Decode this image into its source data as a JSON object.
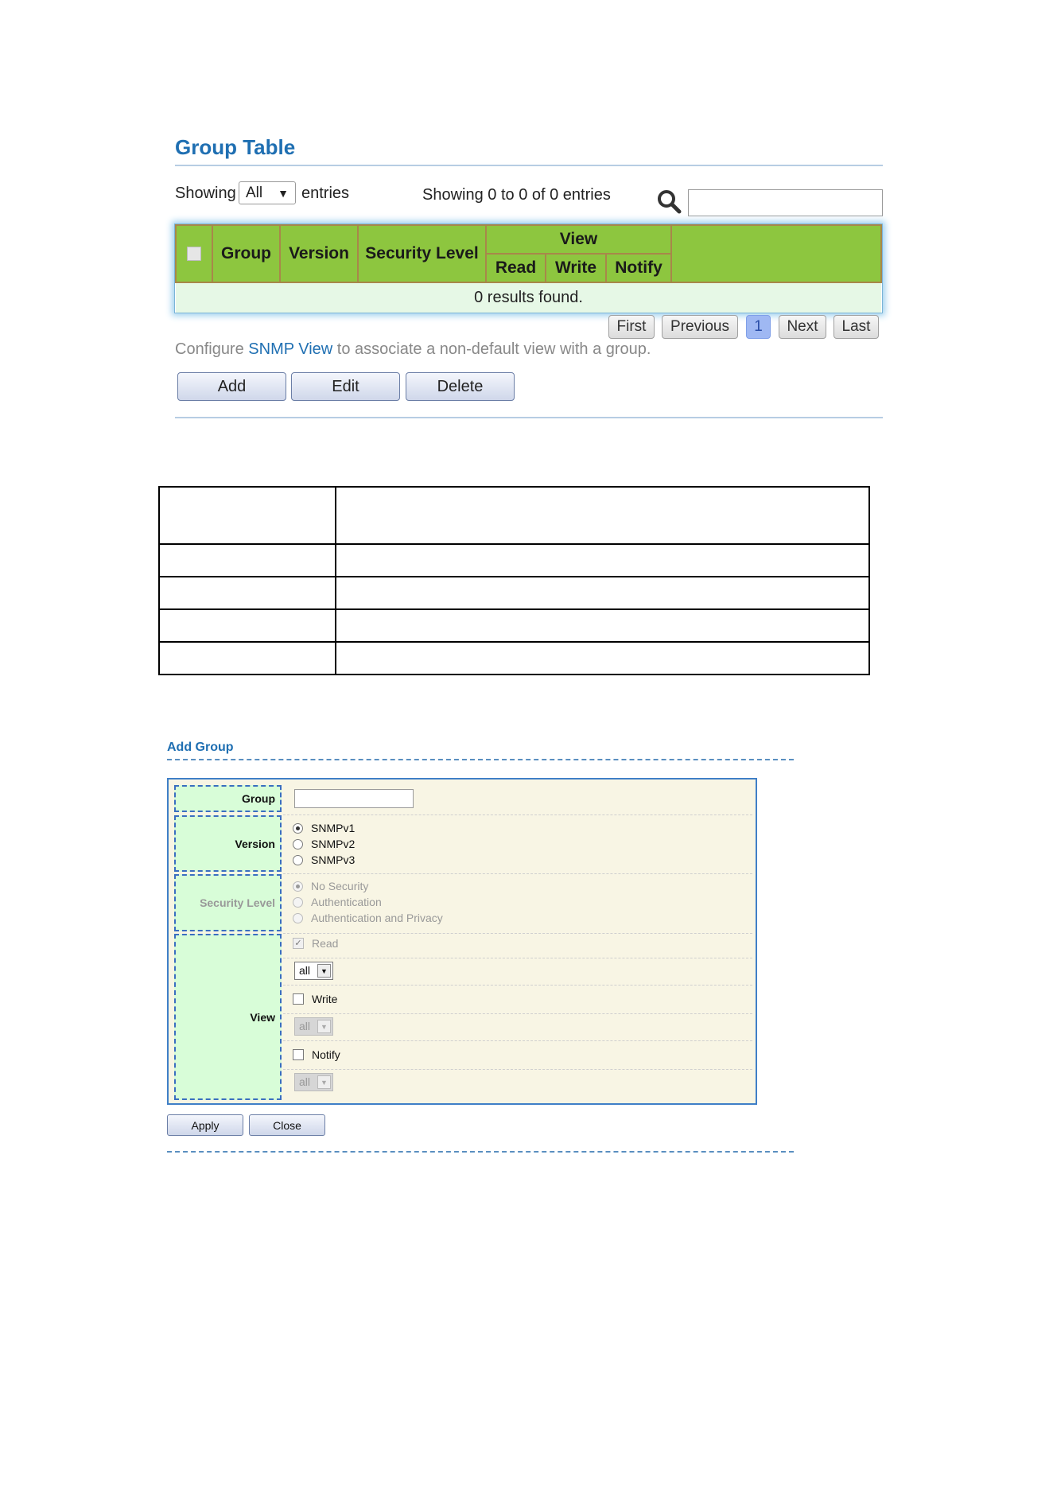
{
  "group_table": {
    "title": "Group Table",
    "showing_label": "Showing",
    "page_size_value": "All",
    "entries_label": "entries",
    "info": "Showing 0 to 0 of 0 entries",
    "search_placeholder": "",
    "columns": {
      "group": "Group",
      "version": "Version",
      "security_level": "Security Level",
      "view": "View",
      "read": "Read",
      "write": "Write",
      "notify": "Notify"
    },
    "empty_message": "0 results found.",
    "pagination": {
      "first": "First",
      "previous": "Previous",
      "current": "1",
      "next": "Next",
      "last": "Last"
    },
    "note_prefix": "Configure ",
    "note_link": "SNMP View",
    "note_suffix": " to associate a non-default view with a group.",
    "buttons": {
      "add": "Add",
      "edit": "Edit",
      "delete": "Delete"
    }
  },
  "add_group": {
    "title": "Add Group",
    "group_label": "Group",
    "group_value": "",
    "version_label": "Version",
    "versions": [
      "SNMPv1",
      "SNMPv2",
      "SNMPv3"
    ],
    "version_selected": "SNMPv1",
    "security_level_label": "Security Level",
    "security_levels": [
      "No Security",
      "Authentication",
      "Authentication and Privacy"
    ],
    "security_level_selected": "No Security",
    "view_label": "View",
    "read_label": "Read",
    "read_view": "all",
    "write_label": "Write",
    "write_view": "all",
    "notify_label": "Notify",
    "notify_view": "all",
    "apply_label": "Apply",
    "close_label": "Close"
  },
  "colors": {
    "accent_blue": "#1f6fb2",
    "header_green": "#8dc63f",
    "label_green": "#d8fdd8",
    "panel_bg": "#f8f5e4",
    "page_active": "#9fb8f3"
  }
}
